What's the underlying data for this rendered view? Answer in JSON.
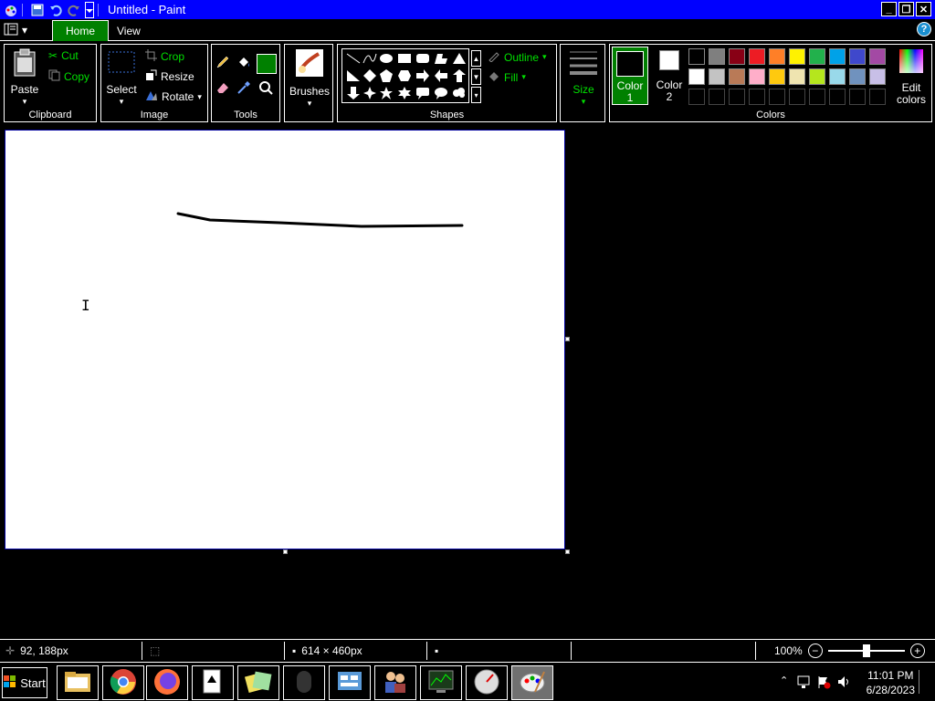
{
  "window": {
    "title": "Untitled - Paint"
  },
  "tabs": [
    {
      "label": "Home"
    },
    {
      "label": "View"
    }
  ],
  "ribbon": {
    "clipboard": {
      "paste": "Paste",
      "cut": "Cut",
      "copy": "Copy",
      "label": "Clipboard"
    },
    "image": {
      "select": "Select",
      "crop": "Crop",
      "resize": "Resize",
      "rotate": "Rotate",
      "label": "Image"
    },
    "tools": {
      "label": "Tools"
    },
    "brushes": {
      "label": "Brushes"
    },
    "shapes": {
      "outline": "Outline",
      "fill": "Fill",
      "label": "Shapes"
    },
    "size": {
      "label": "Size"
    },
    "colors": {
      "color1": "Color 1",
      "color2": "Color 2",
      "edit": "Edit colors",
      "label": "Colors",
      "color1_value": "#000000",
      "color2_value": "#ffffff",
      "palette_row1": [
        "#000000",
        "#7f7f7f",
        "#880015",
        "#ed1c24",
        "#ff7f27",
        "#fff200",
        "#22b14c",
        "#00a2e8",
        "#3f48cc",
        "#a349a4"
      ],
      "palette_row2": [
        "#ffffff",
        "#c3c3c3",
        "#b97a57",
        "#ffaec9",
        "#ffc90e",
        "#efe4b0",
        "#b5e61d",
        "#99d9ea",
        "#7092be",
        "#c8bfe7"
      ]
    }
  },
  "status": {
    "cursor_pos": "92, 188px",
    "image_size": "614 × 460px",
    "zoom": "100%",
    "zoom_level": 1.0
  },
  "taskbar": {
    "start": "Start",
    "time": "11:01 PM",
    "date": "6/28/2023"
  },
  "accent": {
    "title_bar": "#0000ff",
    "active_tab": "#008000",
    "ribbon_text": "#00e000"
  }
}
